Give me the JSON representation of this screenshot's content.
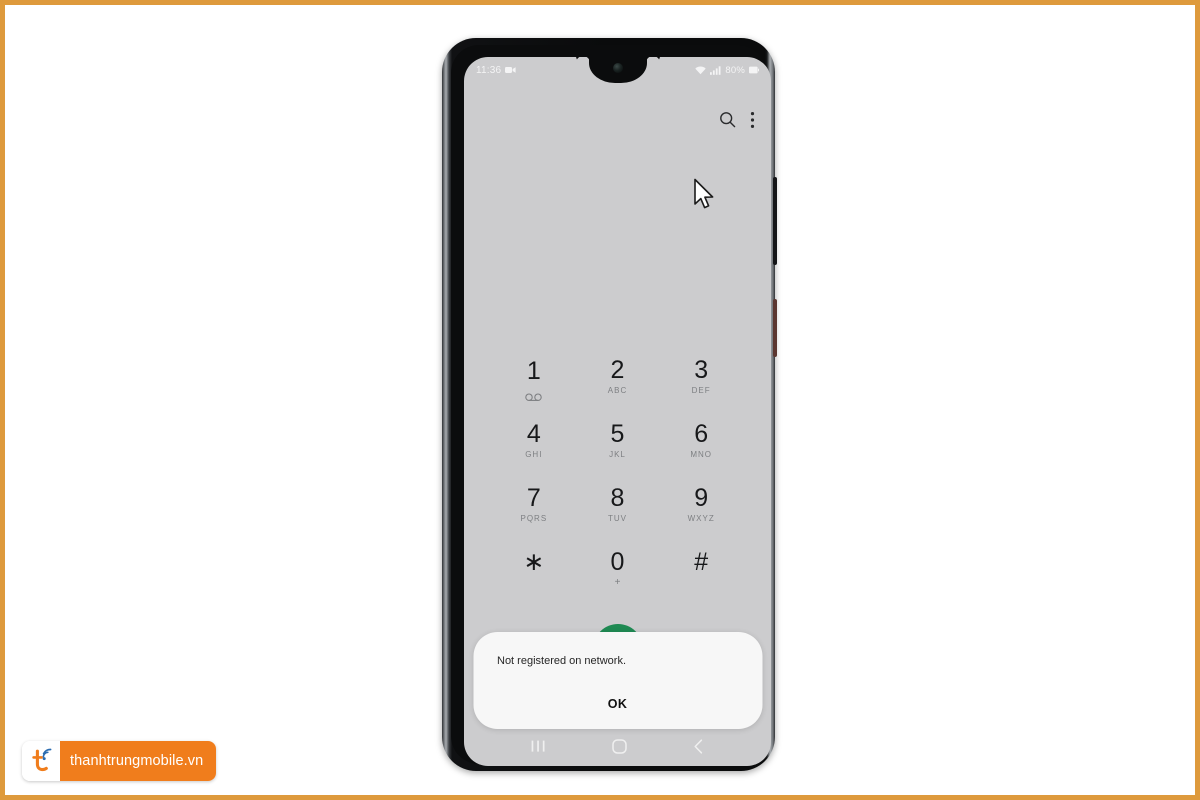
{
  "theme": {
    "page_border_color": "#de9a3c",
    "screen_background": "#ccccce",
    "call_button_color": "#1f8a53",
    "watermark_accent": "#f07d1c",
    "dialog_background": "#f7f7f7"
  },
  "status_bar": {
    "time": "11:36",
    "left_icons": [
      "screen-recorder-icon"
    ],
    "right_icons": [
      "wifi-icon",
      "signal-icon"
    ],
    "battery_percent": "80%",
    "battery_icon": "battery-icon"
  },
  "app_bar": {
    "search_icon": "search-icon",
    "overflow_icon": "more-vertical-icon"
  },
  "keypad": {
    "keys": [
      {
        "digit": "1",
        "sub": "",
        "icon": "voicemail-icon"
      },
      {
        "digit": "2",
        "sub": "ABC",
        "icon": ""
      },
      {
        "digit": "3",
        "sub": "DEF",
        "icon": ""
      },
      {
        "digit": "4",
        "sub": "GHI",
        "icon": ""
      },
      {
        "digit": "5",
        "sub": "JKL",
        "icon": ""
      },
      {
        "digit": "6",
        "sub": "MNO",
        "icon": ""
      },
      {
        "digit": "7",
        "sub": "PQRS",
        "icon": ""
      },
      {
        "digit": "8",
        "sub": "TUV",
        "icon": ""
      },
      {
        "digit": "9",
        "sub": "WXYZ",
        "icon": ""
      },
      {
        "digit": "∗",
        "sub": "",
        "icon": ""
      },
      {
        "digit": "0",
        "sub": "+",
        "icon": ""
      },
      {
        "digit": "#",
        "sub": "",
        "icon": ""
      }
    ]
  },
  "call_button": {
    "icon": "call-icon"
  },
  "dialog": {
    "message": "Not registered on network.",
    "ok_label": "OK"
  },
  "nav_bar": {
    "recents_icon": "recents-icon",
    "home_icon": "home-icon",
    "back_icon": "back-icon"
  },
  "cursor": {
    "icon": "mouse-pointer-icon"
  },
  "watermark": {
    "logo_icon": "thanhtrung-logo-icon",
    "text": "thanhtrungmobile.vn"
  }
}
